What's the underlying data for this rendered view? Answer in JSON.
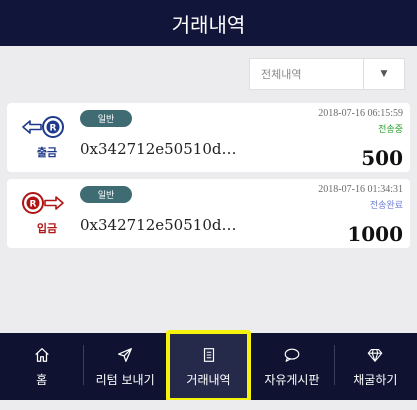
{
  "header": {
    "title": "거래내역"
  },
  "filter": {
    "selected": "전체내역"
  },
  "transactions": [
    {
      "type_label": "출금",
      "type_color": "#1f3a8a",
      "badge": "일반",
      "address": "0x342712e50510d…",
      "date": "2018-07-16 06:15:59",
      "status": "전송중",
      "status_color": "#2e9e2e",
      "amount": "500"
    },
    {
      "type_label": "입금",
      "type_color": "#b01515",
      "badge": "일반",
      "address": "0x342712e50510d…",
      "date": "2018-07-16 01:34:31",
      "status": "전송완료",
      "status_color": "#6f7fd6",
      "amount": "1000"
    }
  ],
  "nav": {
    "items": [
      {
        "label": "홈",
        "icon": "home-icon"
      },
      {
        "label": "리텀 보내기",
        "icon": "send-icon"
      },
      {
        "label": "거래내역",
        "icon": "document-icon"
      },
      {
        "label": "자유게시판",
        "icon": "chat-icon"
      },
      {
        "label": "채굴하기",
        "icon": "diamond-icon"
      }
    ],
    "active_index": 2,
    "highlight_color": "#f5f20c"
  }
}
